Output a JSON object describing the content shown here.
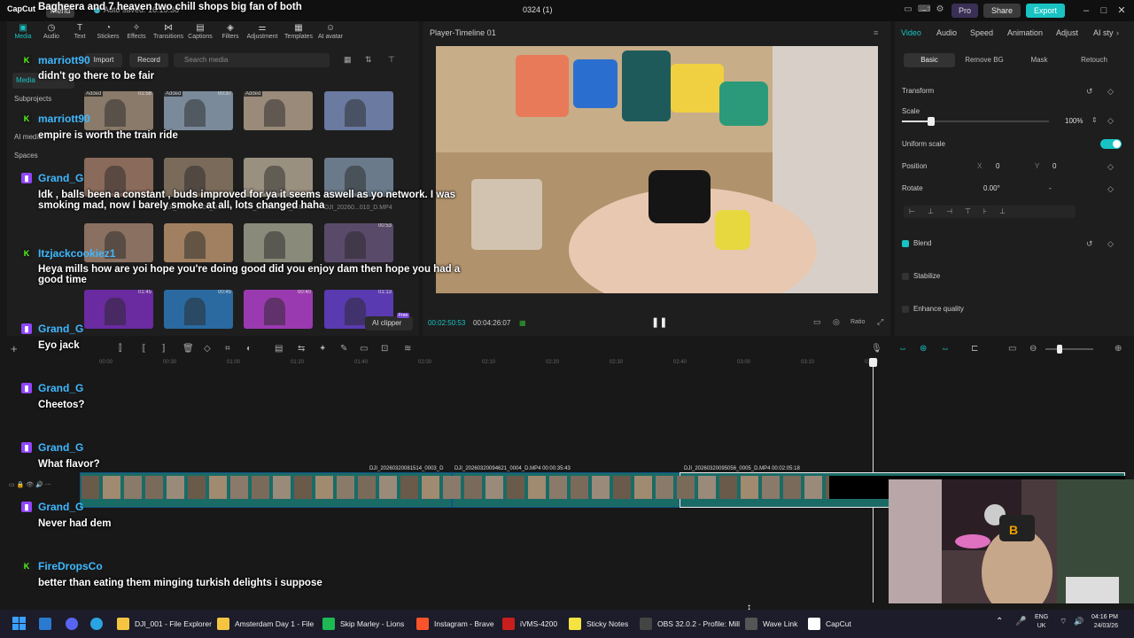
{
  "titlebar": {
    "brand": "CapCut",
    "menu": "Menu",
    "autosave": "Auto saved: 16:15:38",
    "project": "0324 (1)",
    "pro": "Pro",
    "share": "Share",
    "export": "Export"
  },
  "toolbar": {
    "tools": [
      {
        "label": "Media",
        "icon": "media-icon"
      },
      {
        "label": "Audio",
        "icon": "audio-icon"
      },
      {
        "label": "Text",
        "icon": "text-icon"
      },
      {
        "label": "Stickers",
        "icon": "stickers-icon"
      },
      {
        "label": "Effects",
        "icon": "effects-icon"
      },
      {
        "label": "Transitions",
        "icon": "transitions-icon"
      },
      {
        "label": "Captions",
        "icon": "captions-icon"
      },
      {
        "label": "Filters",
        "icon": "filters-icon"
      },
      {
        "label": "Adjustment",
        "icon": "adjustment-icon"
      },
      {
        "label": "Templates",
        "icon": "templates-icon"
      },
      {
        "label": "AI avatar",
        "icon": "ai-avatar-icon"
      }
    ]
  },
  "media": {
    "sidebar": [
      "Media",
      "Subprojects",
      "AI media",
      "Spaces"
    ],
    "import": "Import",
    "record": "Record",
    "search_placeholder": "Search media",
    "ai_clipper": "AI clipper",
    "free": "Free",
    "thumbs": [
      {
        "label": "",
        "added": "Added",
        "dur": "01:58"
      },
      {
        "label": "",
        "added": "Added",
        "dur": "00:37"
      },
      {
        "label": "",
        "added": "Added",
        "dur": ""
      },
      {
        "label": "",
        "added": "",
        "dur": ""
      },
      {
        "label": "",
        "added": "",
        "dur": ""
      },
      {
        "label": "DJI_20260...004_D.MP4",
        "added": "",
        "dur": ""
      },
      {
        "label": "DJI_20260...005_D.MP4",
        "added": "",
        "dur": ""
      },
      {
        "label": "DJI_20260...010_D.MP4",
        "added": "",
        "dur": ""
      },
      {
        "label": "",
        "added": "",
        "dur": ""
      },
      {
        "label": "",
        "added": "",
        "dur": ""
      },
      {
        "label": "",
        "added": "",
        "dur": ""
      },
      {
        "label": "",
        "added": "",
        "dur": "00:53"
      },
      {
        "label": "",
        "added": "",
        "dur": "01:45"
      },
      {
        "label": "",
        "added": "",
        "dur": "00:45"
      },
      {
        "label": "",
        "added": "",
        "dur": "00:40"
      },
      {
        "label": "",
        "added": "",
        "dur": "01:13"
      }
    ]
  },
  "player": {
    "title": "Player-Timeline 01",
    "current": "00:02:50:53",
    "total": "00:04:26:07",
    "ratio": "Ratio"
  },
  "inspector": {
    "tabs": [
      "Video",
      "Audio",
      "Speed",
      "Animation",
      "Adjust",
      "AI sty"
    ],
    "subtabs": [
      "Basic",
      "Remove BG",
      "Mask",
      "Retouch"
    ],
    "transform": "Transform",
    "scale_label": "Scale",
    "scale_value": "100%",
    "scale_level": 0.2,
    "uniform_scale": "Uniform scale",
    "position": "Position",
    "pos_x_label": "X",
    "pos_x": "0",
    "pos_y_label": "Y",
    "pos_y": "0",
    "rotate": "Rotate",
    "rotate_value": "0.00°",
    "rotate_dash": "-",
    "blend": "Blend",
    "stabilize": "Stabilize",
    "enhance": "Enhance quality"
  },
  "timeline": {
    "ticks": [
      "00:00",
      "00:30",
      "01:00",
      "01:20",
      "01:40",
      "02:00",
      "02:10",
      "02:20",
      "02:30",
      "02:40",
      "03:00",
      "03:10",
      "03:20"
    ],
    "clips": [
      {
        "label": "DJI_20260320081514_0003_D",
        "color": "#1a6b66"
      },
      {
        "label": "DJI_20260320094621_0004_D.MP4   00:00:35:43",
        "color": "#1a6b66"
      },
      {
        "label": "DJI_20260320095056_0005_D.MP4   00:02:05:18",
        "color": "#1a6b66"
      }
    ]
  },
  "chat": [
    {
      "platform": "kick",
      "user": "Bagheera and 7 heaven two chill shops big fan of both",
      "color": "#ffffff",
      "msg": ""
    },
    {
      "platform": "kick",
      "user": "marriott90",
      "color": "#3fb8ff",
      "msg": "didn't go there to be fair"
    },
    {
      "platform": "kick",
      "user": "marriott90",
      "color": "#3fb8ff",
      "msg": "empire is worth the train ride"
    },
    {
      "platform": "twitch",
      "user": "Grand_G",
      "color": "#3fb8ff",
      "msg": "Idk , balls been a constant , buds improved for ya it seems aswell as yo network. I was smoking mad, now I barely smoke at all, lots changed haha"
    },
    {
      "platform": "kick",
      "user": "Itzjackcookiez1",
      "color": "#3fb8ff",
      "msg": "Heya mills how are yoi hope you're doing good did you enjoy dam then hope you had a good time"
    },
    {
      "platform": "twitch",
      "user": "Grand_G",
      "color": "#3fb8ff",
      "msg": "Eyo jack"
    },
    {
      "platform": "twitch",
      "user": "Grand_G",
      "color": "#3fb8ff",
      "msg": "Cheetos?"
    },
    {
      "platform": "twitch",
      "user": "Grand_G",
      "color": "#3fb8ff",
      "msg": "What flavor?"
    },
    {
      "platform": "twitch",
      "user": "Grand_G",
      "color": "#3fb8ff",
      "msg": "Never had dem"
    },
    {
      "platform": "kick",
      "user": "FireDropsCo",
      "color": "#3fb8ff",
      "msg": "better than eating them minging turkish delights i suppose"
    }
  ],
  "taskbar": {
    "items": [
      {
        "label": "DJI_001 - File Explorer",
        "color": "#f5c542"
      },
      {
        "label": "Amsterdam Day 1 - File",
        "color": "#f5c542"
      },
      {
        "label": "Skip Marley - Lions",
        "color": "#1db954"
      },
      {
        "label": "Instagram - Brave",
        "color": "#fb542b"
      },
      {
        "label": "iVMS-4200",
        "color": "#c81e1e"
      },
      {
        "label": "Sticky Notes",
        "color": "#f5e342"
      },
      {
        "label": "OBS 32.0.2 - Profile: Mill",
        "color": "#444444"
      },
      {
        "label": "Wave Link",
        "color": "#555555"
      },
      {
        "label": "CapCut",
        "color": "#ffffff"
      }
    ],
    "lang": "ENG",
    "region": "UK",
    "time": "04:16 PM",
    "date": "24/03/26"
  },
  "colors": {
    "accent": "#19c3c3",
    "twitch": "#9146ff",
    "kick": "#53fc18"
  }
}
